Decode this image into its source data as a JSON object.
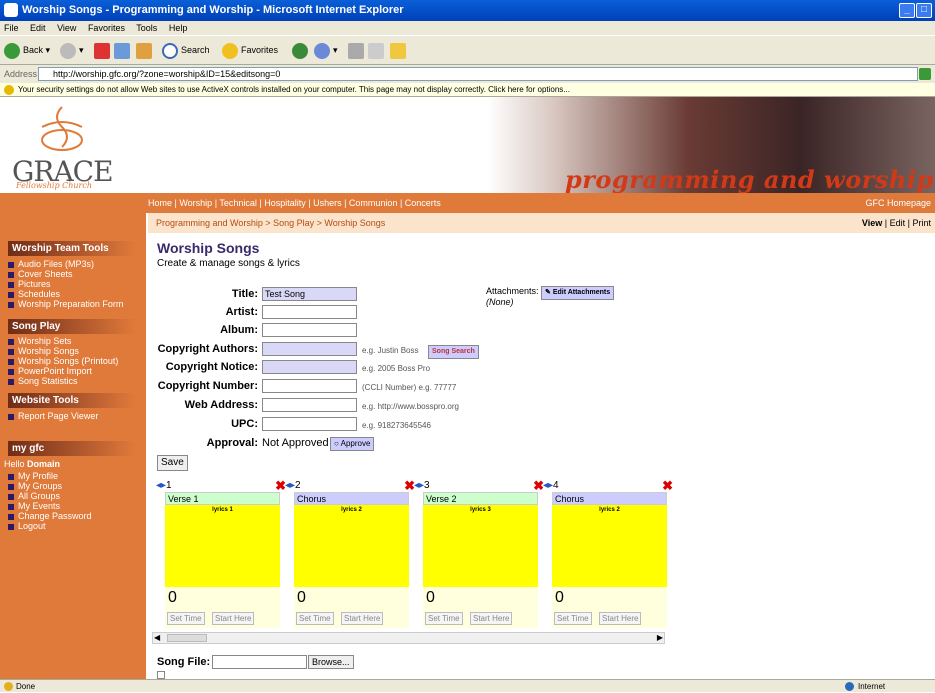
{
  "window": {
    "title": "Worship Songs - Programming and Worship - Microsoft Internet Explorer",
    "min": "_",
    "max": "□"
  },
  "menubar": [
    "File",
    "Edit",
    "View",
    "Favorites",
    "Tools",
    "Help"
  ],
  "toolbar": {
    "back": "Back",
    "search": "Search",
    "favorites": "Favorites"
  },
  "address": {
    "label": "Address",
    "url": "http://worship.gfc.org/?zone=worship&ID=15&editsong=0",
    "go": "Go"
  },
  "infobar": "Your security settings do not allow Web sites to use ActiveX controls installed on your computer. This page may not display correctly. Click here for options...",
  "logo": {
    "name": "GRACE",
    "tagline": "Fellowship Church"
  },
  "banner": "programming and worship",
  "nav": {
    "links": "Home | Worship | Technical | Hospitality | Ushers | Communion | Concerts",
    "homepage": "GFC Homepage"
  },
  "breadcrumb": "Programming and Worship > Song Play > Worship Songs",
  "view_edit": {
    "view": "View",
    "edit": "| Edit |",
    "print": "Print"
  },
  "sidebar": {
    "worship_tools": "Worship Team Tools",
    "worship_items": [
      "Audio Files (MP3s)",
      "Cover Sheets",
      "Pictures",
      "Schedules",
      "Worship Preparation Form"
    ],
    "song_play": "Song Play",
    "song_items": [
      "Worship Sets",
      "Worship Songs",
      "Worship Songs (Printout)",
      "PowerPoint Import",
      "Song Statistics"
    ],
    "website_tools": "Website Tools",
    "website_items": [
      "Report Page Viewer"
    ],
    "mygfc": "my gfc",
    "hello": "Hello",
    "user": "Domain",
    "mygfc_items": [
      "My Profile",
      "My Groups",
      "All Groups",
      "My Events",
      "Change Password",
      "Logout"
    ]
  },
  "page": {
    "title": "Worship Songs",
    "subtitle": "Create & manage songs & lyrics"
  },
  "form": {
    "title_label": "Title:",
    "title_value": "Test Song",
    "artist_label": "Artist:",
    "album_label": "Album:",
    "copyright_authors_label": "Copyright Authors:",
    "copyright_authors_hint": "e.g. Justin Boss",
    "song_search": "Song Search",
    "copyright_notice_label": "Copyright Notice:",
    "copyright_notice_hint": "e.g. 2005 Boss Pro",
    "copyright_number_label": "Copyright Number:",
    "copyright_number_hint": "(CCLI Number) e.g. 77777",
    "web_label": "Web Address:",
    "web_hint": "e.g. http://www.bosspro.org",
    "upc_label": "UPC:",
    "upc_hint": "e.g. 918273645546",
    "approval_label": "Approval:",
    "approval_value": "Not Approved",
    "approve_button": "Approve",
    "save_button": "Save",
    "attachments_label": "Attachments:",
    "attachments_value": "(None)",
    "edit_attachments": "Edit Attachments",
    "song_file_label": "Song File:",
    "browse_button": "Browse..."
  },
  "lyrics": [
    {
      "num": "1",
      "name": "Verse 1",
      "lyric": "lyrics 1",
      "count": "0",
      "color": "#ccffcc"
    },
    {
      "num": "2",
      "name": "Chorus",
      "lyric": "lyrics 2",
      "count": "0",
      "color": "#ccccff"
    },
    {
      "num": "3",
      "name": "Verse 2",
      "lyric": "lyrics 3",
      "count": "0",
      "color": "#ccffcc"
    },
    {
      "num": "4",
      "name": "Chorus",
      "lyric": "lyrics 2",
      "count": "0",
      "color": "#ccccff"
    }
  ],
  "lyric_buttons": {
    "set_time": "Set Time",
    "start_here": "Start Here"
  },
  "status": {
    "left": "Done",
    "right": "Internet"
  }
}
